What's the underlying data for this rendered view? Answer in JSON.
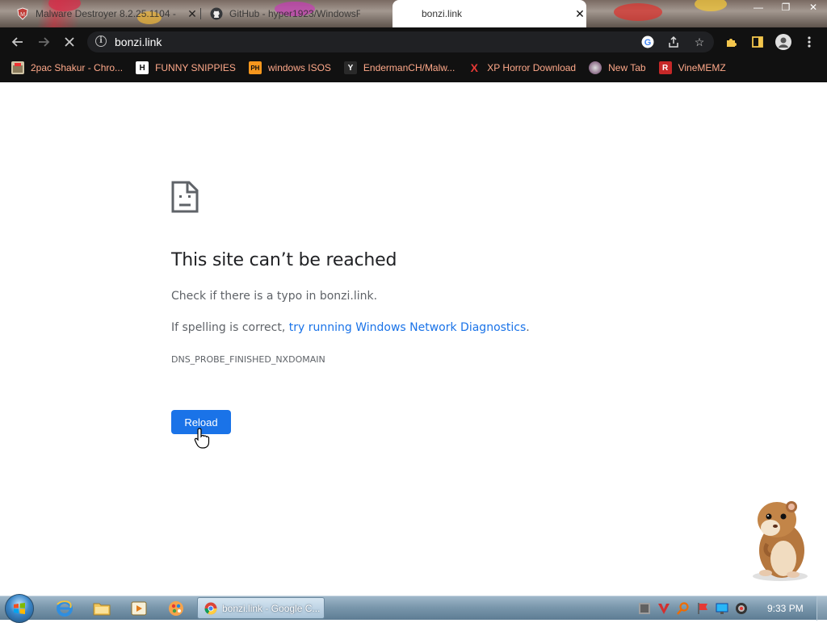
{
  "tabs": [
    {
      "title": "Malware Destroyer 8.2.25.1104 -",
      "active": false
    },
    {
      "title": "GitHub - hyper1923/WindowsF",
      "active": false
    },
    {
      "title": "bonzi.link",
      "active": true
    }
  ],
  "toolbar": {
    "url": "bonzi.link"
  },
  "bookmarks": [
    {
      "label": "2pac Shakur - Chro...",
      "icon": "bookmark-favicon"
    },
    {
      "label": "FUNNY SNIPPIES",
      "icon": "h-logo-icon",
      "glyph": "H"
    },
    {
      "label": "windows ISOS",
      "icon": "ph-logo-icon",
      "glyph": "PH"
    },
    {
      "label": "EndermanCH/Malw...",
      "icon": "yp-logo-icon",
      "glyph": "Y"
    },
    {
      "label": "XP Horror Download",
      "icon": "x-logo-icon",
      "glyph": "X"
    },
    {
      "label": "New Tab",
      "icon": "globe-avatar-icon",
      "glyph": ""
    },
    {
      "label": "VineMEMZ",
      "icon": "r-logo-icon",
      "glyph": "R"
    }
  ],
  "error_page": {
    "title": "This site can’t be reached",
    "line1": "Check if there is a typo in bonzi.link.",
    "line2_prefix": "If spelling is correct, ",
    "line2_link": "try running Windows Network Diagnostics",
    "line2_suffix": ".",
    "error_code": "DNS_PROBE_FINISHED_NXDOMAIN",
    "reload_label": "Reload"
  },
  "taskbar": {
    "active_task_label": "bonzi.link - Google C...",
    "clock": "9:33 PM"
  },
  "colors": {
    "link_blue": "#1a73e8",
    "reload_button": "#1a73e8",
    "bookmark_text": "#ffa98a",
    "toolbar_bg": "#111111"
  }
}
